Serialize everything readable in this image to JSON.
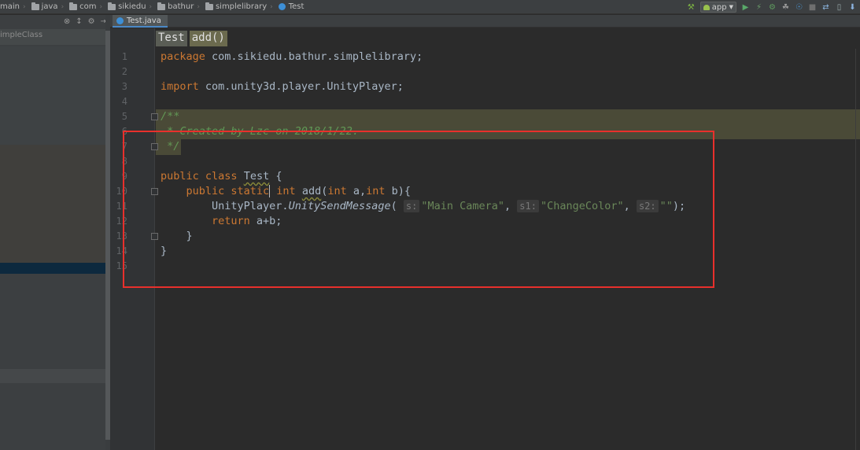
{
  "breadcrumbs": [
    {
      "label": "main",
      "type": "folder"
    },
    {
      "label": "java",
      "type": "folder"
    },
    {
      "label": "com",
      "type": "folder"
    },
    {
      "label": "sikiedu",
      "type": "folder"
    },
    {
      "label": "bathur",
      "type": "folder"
    },
    {
      "label": "simplelibrary",
      "type": "folder"
    },
    {
      "label": "Test",
      "type": "class"
    }
  ],
  "toolbar": {
    "run_config": "app",
    "icons": [
      "hammer-icon",
      "run-icon",
      "debug-icon",
      "coverage-icon",
      "profile-icon",
      "attach-debugger-icon",
      "stop-icon",
      "sync-icon",
      "avd-icon",
      "sdk-icon"
    ]
  },
  "project_panel": {
    "title": "impleClass",
    "toolbar_icons": [
      "settings-icon",
      "collapse-icon",
      "gear-icon",
      "hide-icon"
    ]
  },
  "tabs": [
    {
      "label": "Test.java",
      "active": true
    }
  ],
  "editor_breadcrumbs": [
    "Test",
    "add()"
  ],
  "line_numbers": [
    "1",
    "2",
    "3",
    "4",
    "5",
    "6",
    "7",
    "8",
    "9",
    "10",
    "11",
    "12",
    "13",
    "14",
    "15"
  ],
  "code": {
    "l1_kw": "package",
    "l1_rest": " com.sikiedu.bathur.simplelibrary;",
    "l3_kw": "import",
    "l3_rest": " com.unity3d.player.UnityPlayer;",
    "l5": "/**",
    "l6": " * Created by Lzc on 2018/1/22.",
    "l7": " */",
    "l9_kw": "public class",
    "l9_name": "Test",
    "l9_rest": " {",
    "l10_kw1": "    public static",
    "l10_kw2": " int",
    "l10_name": "add",
    "l10_rest_a": "(",
    "l10_int1": "int",
    "l10_rest_b": " a,",
    "l10_int2": "int",
    "l10_rest_c": " b){",
    "l11_prefix": "        UnityPlayer.",
    "l11_method": "UnitySendMessage",
    "l11_open": "(",
    "l11_hint1": "s:",
    "l11_arg1": "\"Main Camera\"",
    "l11_comma1": ",",
    "l11_hint2": "s1:",
    "l11_arg2": "\"ChangeColor\"",
    "l11_comma2": ",",
    "l11_hint3": "s2:",
    "l11_arg3": "\"\"",
    "l11_close": ");",
    "l12_kw": "        return",
    "l12_rest": " a+b;",
    "l13": "    }",
    "l14": "}"
  }
}
